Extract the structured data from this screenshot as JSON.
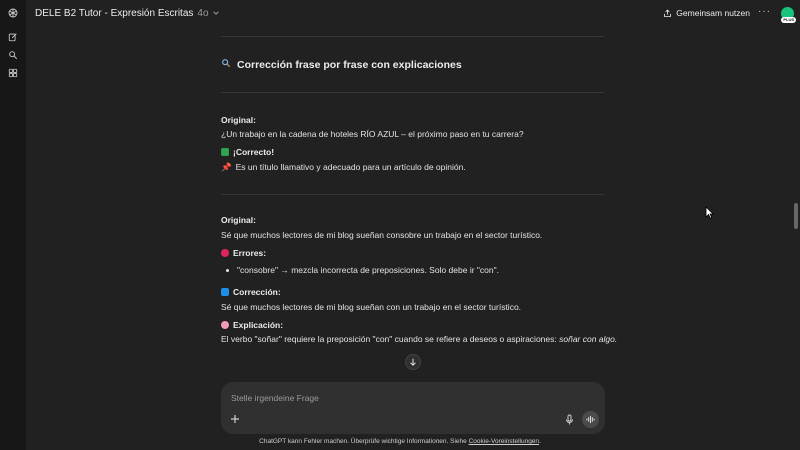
{
  "header": {
    "title": "DELE B2 Tutor - Expresión Escritas",
    "model": "4o",
    "share_label": "Gemeinsam nutzen",
    "more_label": "···",
    "plan_badge": "PLUS"
  },
  "section": {
    "icon": "magnifier-icon",
    "heading": "Corrección frase por frase con explicaciones"
  },
  "items": [
    {
      "original_label": "Original:",
      "original_text": "¿Un trabajo en la cadena de hoteles RÍO AZUL – el próximo paso en tu carrera?",
      "verdict_label": "¡Correcto!",
      "note": "Es un título llamativo y adecuado para un artículo de opinión."
    },
    {
      "original_label": "Original:",
      "original_text": "Sé que muchos lectores de mi blog sueñan consobre un trabajo en el sector turístico.",
      "errors_label": "Errores:",
      "error_bullet": "\"consobre\" → mezcla incorrecta de preposiciones. Solo debe ir \"con\".",
      "correction_label": "Corrección:",
      "correction_text": "Sé que muchos lectores de mi blog sueñan con un trabajo en el sector turístico.",
      "explanation_label": "Explicación:",
      "explanation_text": "El verbo \"soñar\" requiere la preposición \"con\" cuando se refiere a deseos o aspiraciones: ",
      "explanation_example": "soñar con algo."
    }
  ],
  "composer": {
    "placeholder": "Stelle irgendeine Frage"
  },
  "footer": {
    "text": "ChatGPT kann Fehler machen. Überprüfe wichtige Informationen. Siehe ",
    "link": "Cookie-Voreinstellungen",
    "end": "."
  },
  "colors": {
    "background": "#212121",
    "sidebar": "#171717",
    "composer": "#303030",
    "check": "#2ea44f",
    "error": "#e0245e",
    "correction": "#1d8fe8",
    "explanation": "#f29bb7"
  }
}
